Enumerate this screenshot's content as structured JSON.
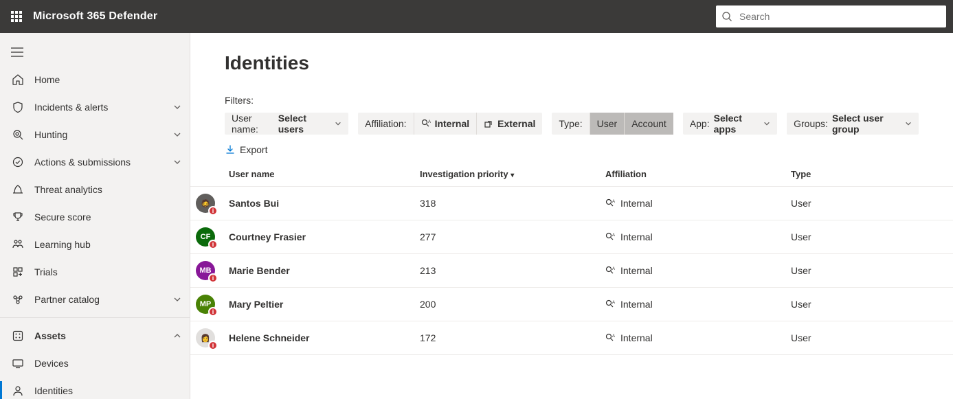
{
  "app_title": "Microsoft 365 Defender",
  "search": {
    "placeholder": "Search"
  },
  "sidebar": {
    "items": [
      {
        "id": "home",
        "label": "Home",
        "expandable": false
      },
      {
        "id": "incidents",
        "label": "Incidents & alerts",
        "expandable": true
      },
      {
        "id": "hunting",
        "label": "Hunting",
        "expandable": true
      },
      {
        "id": "actions",
        "label": "Actions & submissions",
        "expandable": true
      },
      {
        "id": "threat",
        "label": "Threat analytics",
        "expandable": false
      },
      {
        "id": "secure",
        "label": "Secure score",
        "expandable": false
      },
      {
        "id": "learning",
        "label": "Learning hub",
        "expandable": false
      },
      {
        "id": "trials",
        "label": "Trials",
        "expandable": false
      },
      {
        "id": "partner",
        "label": "Partner catalog",
        "expandable": true
      },
      {
        "id": "assets",
        "label": "Assets",
        "expandable": true,
        "bold": true
      },
      {
        "id": "devices",
        "label": "Devices",
        "expandable": false
      },
      {
        "id": "identities",
        "label": "Identities",
        "expandable": false,
        "active": true
      }
    ]
  },
  "page": {
    "title": "Identities",
    "filters_label": "Filters:",
    "filters": {
      "username": {
        "prefix": "User name:",
        "value": "Select users"
      },
      "affiliation": {
        "prefix": "Affiliation:",
        "opt_internal": "Internal",
        "opt_external": "External"
      },
      "type": {
        "prefix": "Type:",
        "opt_user": "User",
        "opt_account": "Account"
      },
      "app": {
        "prefix": "App:",
        "value": "Select apps"
      },
      "groups": {
        "prefix": "Groups:",
        "value": "Select user group"
      }
    },
    "toolbar": {
      "export": "Export"
    },
    "columns": {
      "user": "User name",
      "priority": "Investigation priority",
      "affiliation": "Affiliation",
      "type": "Type"
    },
    "rows": [
      {
        "name": "Santos Bui",
        "priority": "318",
        "affiliation": "Internal",
        "type": "User",
        "avatar": {
          "class": "avatar-img",
          "initials": "🧔"
        }
      },
      {
        "name": "Courtney Frasier",
        "priority": "277",
        "affiliation": "Internal",
        "type": "User",
        "avatar": {
          "class": "avatar-cf",
          "initials": "CF"
        }
      },
      {
        "name": "Marie Bender",
        "priority": "213",
        "affiliation": "Internal",
        "type": "User",
        "avatar": {
          "class": "avatar-mb",
          "initials": "MB"
        }
      },
      {
        "name": "Mary Peltier",
        "priority": "200",
        "affiliation": "Internal",
        "type": "User",
        "avatar": {
          "class": "avatar-mp",
          "initials": "MP"
        }
      },
      {
        "name": "Helene Schneider",
        "priority": "172",
        "affiliation": "Internal",
        "type": "User",
        "avatar": {
          "class": "avatar-hs",
          "initials": "👩"
        }
      }
    ]
  }
}
